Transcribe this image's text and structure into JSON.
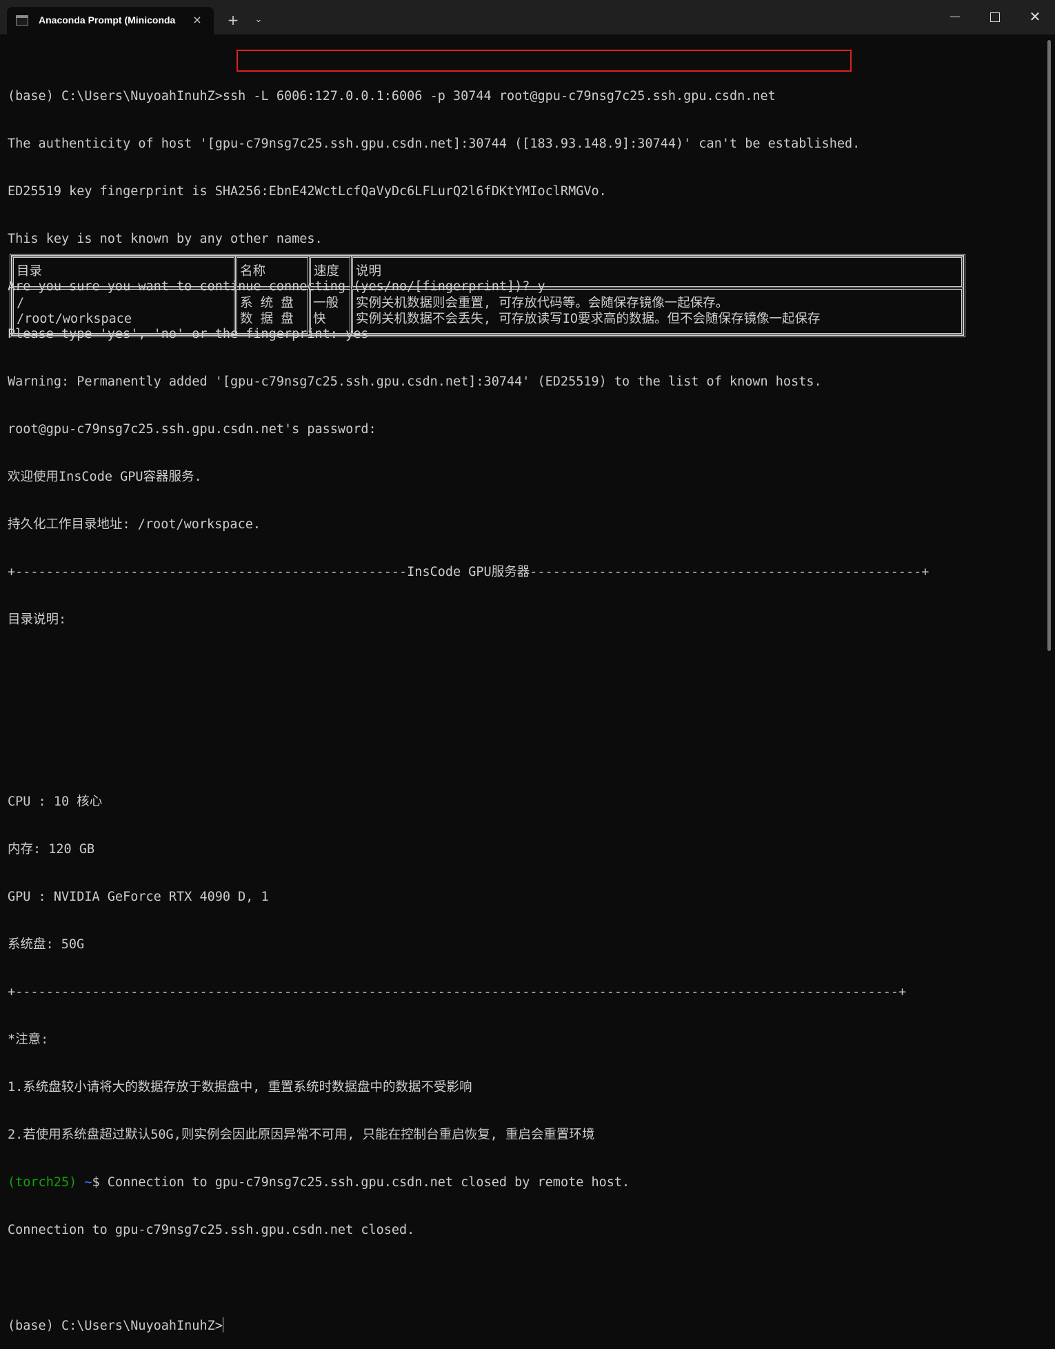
{
  "window": {
    "tab_title": "Anaconda Prompt (Miniconda",
    "tab_icon": "terminal-icon",
    "tab_close": "×",
    "new_tab": "+",
    "dropdown": "⌄",
    "minimize_icon": "minimize-icon",
    "maximize_icon": "maximize-icon",
    "close": "✕"
  },
  "terminal": {
    "lines": [
      "(base) C:\\Users\\NuyoahInuhZ>ssh -L 6006:127.0.0.1:6006 -p 30744 root@gpu-c79nsg7c25.ssh.gpu.csdn.net",
      "The authenticity of host '[gpu-c79nsg7c25.ssh.gpu.csdn.net]:30744 ([183.93.148.9]:30744)' can't be established.",
      "ED25519 key fingerprint is SHA256:EbnE42WctLcfQaVyDc6LFLurQ2l6fDKtYMIoclRMGVo.",
      "This key is not known by any other names.",
      "Are you sure you want to continue connecting (yes/no/[fingerprint])? y",
      "Please type 'yes', 'no' or the fingerprint: yes",
      "Warning: Permanently added '[gpu-c79nsg7c25.ssh.gpu.csdn.net]:30744' (ED25519) to the list of known hosts.",
      "root@gpu-c79nsg7c25.ssh.gpu.csdn.net's password:",
      "欢迎使用InsCode GPU容器服务.",
      "持久化工作目录地址: /root/workspace.",
      "+---------------------------------------------------InsCode GPU服务器---------------------------------------------------+",
      "目录说明:"
    ],
    "table": {
      "headers": [
        "目录",
        "名称",
        "速度",
        "说明"
      ],
      "row_col1": "/\n/root/workspace",
      "row_col2": "系 统 盘\n数 据 盘",
      "row_col3": "一般\n快",
      "row_col4": "实例关机数据则会重置, 可存放代码等。会随保存镜像一起保存。\n实例关机数据不会丢失, 可存放读写IO要求高的数据。但不会随保存镜像一起保存"
    },
    "lines_after": [
      "CPU : 10 核心",
      "内存: 120 GB",
      "GPU : NVIDIA GeForce RTX 4090 D, 1",
      "系统盘: 50G",
      "+-------------------------------------------------------------------------------------------------------------------+",
      "*注意:",
      "1.系统盘较小请将大的数据存放于数据盘中, 重置系统时数据盘中的数据不受影响",
      "2.若使用系统盘超过默认50G,则实例会因此原因异常不可用, 只能在控制台重启恢复, 重启会重置环境"
    ],
    "env_name": "(torch25)",
    "tilde": "~",
    "remote_msg": "$ Connection to gpu-c79nsg7c25.ssh.gpu.csdn.net closed by remote host.",
    "closed_msg": "Connection to gpu-c79nsg7c25.ssh.gpu.csdn.net closed.",
    "prompt": "(base) C:\\Users\\NuyoahInuhZ>"
  },
  "colors": {
    "background": "#0c0c0c",
    "text": "#cccccc",
    "env_green": "#13a10e",
    "tilde_blue": "#3b78ff",
    "highlight_red": "#e02020"
  }
}
